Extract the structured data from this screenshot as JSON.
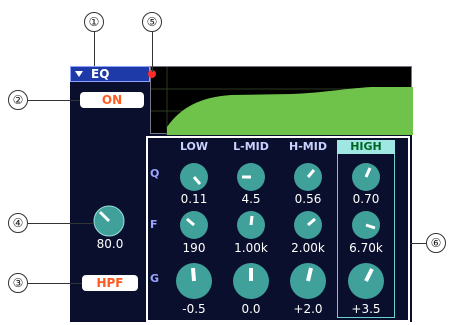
{
  "callouts": [
    "①",
    "②",
    "③",
    "④",
    "⑤",
    "⑥"
  ],
  "eq_header": {
    "title": "EQ"
  },
  "eq_on_button": {
    "label": "ON"
  },
  "hpf_button": {
    "label": "HPF"
  },
  "hpf_frequency": {
    "value": "80.0"
  },
  "row_labels": [
    "Q",
    "F",
    "G"
  ],
  "bands": [
    {
      "name": "LOW",
      "q": "0.11",
      "f": "190",
      "g": "-0.5"
    },
    {
      "name": "L-MID",
      "q": "4.5",
      "f": "1.00k",
      "g": "0.0"
    },
    {
      "name": "H-MID",
      "q": "0.56",
      "f": "2.00k",
      "g": "+2.0"
    },
    {
      "name": "HIGH",
      "q": "0.70",
      "f": "6.70k",
      "g": "+3.5"
    }
  ],
  "selected_band": "HIGH",
  "colors": {
    "panel": "#0b0f2e",
    "header": "#1e3aa8",
    "knob": "#3fa19a",
    "curve": "#6fc24a",
    "accent": "#ff5a1f",
    "indicator": "#ff2a2a"
  },
  "icons": {
    "header_menu": "triangle-down-icon",
    "indicator": "red-dot-icon"
  }
}
